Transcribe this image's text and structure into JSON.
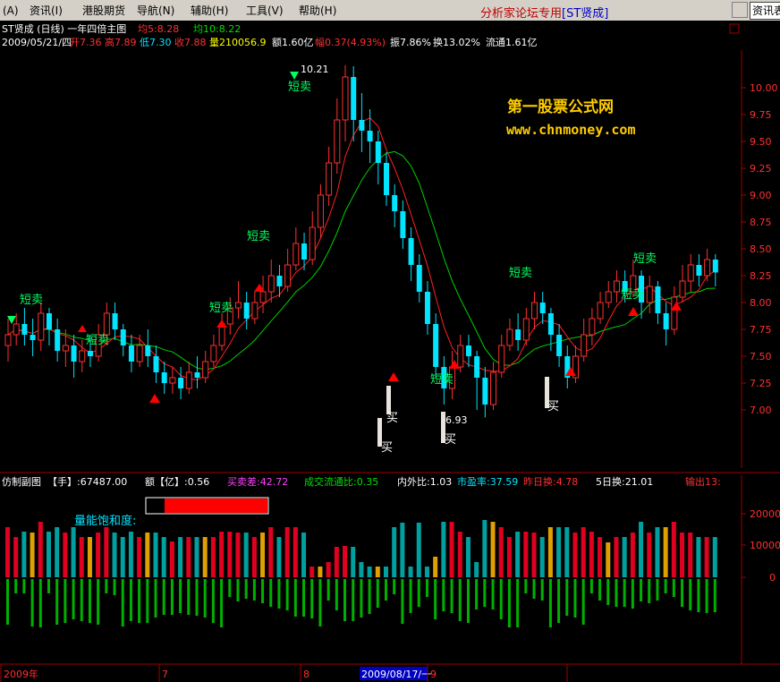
{
  "menubar": {
    "items": [
      "(A)",
      "资讯(I)",
      "港股期货",
      "导航(N)",
      "辅助(H)",
      "工具(V)",
      "帮助(H)"
    ],
    "accent_label": "分析家论坛专用",
    "accent_tag": "[ST贤成]",
    "search_label": "资讯表"
  },
  "chart_header": {
    "title": "ST贤成 (日线) 一年四倍主图",
    "ma5_label": "均5:8.28",
    "ma10_label": "均10:8.22",
    "date": "2009/05/21/四",
    "open": "开7.36",
    "high": "高7.89",
    "low": "低7.30",
    "close": "收7.88",
    "volume": "量210056.9",
    "amount": "额1.60亿",
    "change": "幅0.37(4.93%)",
    "amplitude": "振7.86%",
    "turnover": "换13.02%",
    "float": "流通1.61亿"
  },
  "watermark": {
    "line1": "第一股票公式网",
    "line2": "www.chnmoney.com"
  },
  "annotations": {
    "sell": "短卖",
    "buy": "买",
    "peak_label": "10.21",
    "low_label": "6.93"
  },
  "sub_header": {
    "title": "仿制副图",
    "hand": "【手】:67487.00",
    "amount_yi": "额【亿】:0.56",
    "buy_sell_diff": "买卖差:42.72",
    "circ_ratio": "成交流通比:0.35",
    "in_out_ratio": "内外比:1.03",
    "pe": "市盈率:37.59",
    "yesterday_turn": "昨日换:4.78",
    "five_day_turn": "5日换:21.01",
    "output": "输出13:"
  },
  "saturation_label": "量能饱和度:",
  "date_axis": {
    "labels": [
      "2009年",
      "7",
      "8",
      "2009/08/17/一",
      "9"
    ]
  },
  "colors": {
    "up": "#ff3030",
    "down": "#00e4ff",
    "ma5": "#ff3030",
    "ma10": "#00d000",
    "sell_signal": "#00ff60",
    "buy_signal": "#ff0000",
    "watermark": "#ffcc00"
  },
  "chart_data": {
    "type": "candlestick",
    "price_axis": {
      "ticks": [
        "10.00",
        "9.75",
        "9.50",
        "9.25",
        "9.00",
        "8.75",
        "8.50",
        "8.25",
        "8.00",
        "7.75",
        "7.50",
        "7.25",
        "7.00"
      ],
      "range": [
        6.7,
        10.4
      ]
    },
    "volume_axis": {
      "ticks": [
        "20000",
        "10000",
        "0"
      ]
    },
    "candles": [
      {
        "o": 7.6,
        "c": 7.7,
        "h": 7.85,
        "l": 7.45
      },
      {
        "o": 7.7,
        "c": 7.8,
        "h": 7.9,
        "l": 7.6
      },
      {
        "o": 7.8,
        "c": 7.7,
        "h": 7.95,
        "l": 7.6
      },
      {
        "o": 7.7,
        "c": 7.65,
        "h": 7.85,
        "l": 7.5
      },
      {
        "o": 7.65,
        "c": 7.9,
        "h": 8.0,
        "l": 7.55
      },
      {
        "o": 7.9,
        "c": 7.75,
        "h": 7.95,
        "l": 7.6
      },
      {
        "o": 7.75,
        "c": 7.55,
        "h": 7.85,
        "l": 7.45
      },
      {
        "o": 7.55,
        "c": 7.6,
        "h": 7.75,
        "l": 7.4
      },
      {
        "o": 7.6,
        "c": 7.45,
        "h": 7.7,
        "l": 7.3
      },
      {
        "o": 7.45,
        "c": 7.55,
        "h": 7.65,
        "l": 7.35
      },
      {
        "o": 7.55,
        "c": 7.5,
        "h": 7.7,
        "l": 7.4
      },
      {
        "o": 7.5,
        "c": 7.7,
        "h": 7.8,
        "l": 7.45
      },
      {
        "o": 7.7,
        "c": 7.9,
        "h": 8.0,
        "l": 7.6
      },
      {
        "o": 7.9,
        "c": 7.75,
        "h": 8.0,
        "l": 7.65
      },
      {
        "o": 7.75,
        "c": 7.6,
        "h": 7.8,
        "l": 7.5
      },
      {
        "o": 7.6,
        "c": 7.45,
        "h": 7.7,
        "l": 7.35
      },
      {
        "o": 7.45,
        "c": 7.6,
        "h": 7.7,
        "l": 7.4
      },
      {
        "o": 7.6,
        "c": 7.5,
        "h": 7.75,
        "l": 7.4
      },
      {
        "o": 7.5,
        "c": 7.35,
        "h": 7.6,
        "l": 7.25
      },
      {
        "o": 7.35,
        "c": 7.25,
        "h": 7.45,
        "l": 7.15
      },
      {
        "o": 7.25,
        "c": 7.3,
        "h": 7.4,
        "l": 7.15
      },
      {
        "o": 7.3,
        "c": 7.2,
        "h": 7.4,
        "l": 7.1
      },
      {
        "o": 7.2,
        "c": 7.35,
        "h": 7.45,
        "l": 7.15
      },
      {
        "o": 7.35,
        "c": 7.3,
        "h": 7.5,
        "l": 7.2
      },
      {
        "o": 7.3,
        "c": 7.45,
        "h": 7.55,
        "l": 7.25
      },
      {
        "o": 7.45,
        "c": 7.6,
        "h": 7.7,
        "l": 7.4
      },
      {
        "o": 7.6,
        "c": 7.8,
        "h": 7.9,
        "l": 7.55
      },
      {
        "o": 7.8,
        "c": 7.95,
        "h": 8.05,
        "l": 7.7
      },
      {
        "o": 7.95,
        "c": 8.0,
        "h": 8.2,
        "l": 7.85
      },
      {
        "o": 8.0,
        "c": 7.85,
        "h": 8.1,
        "l": 7.75
      },
      {
        "o": 7.85,
        "c": 8.0,
        "h": 8.1,
        "l": 7.8
      },
      {
        "o": 8.0,
        "c": 8.1,
        "h": 8.25,
        "l": 7.9
      },
      {
        "o": 8.1,
        "c": 8.25,
        "h": 8.4,
        "l": 8.0
      },
      {
        "o": 8.25,
        "c": 8.15,
        "h": 8.35,
        "l": 8.05
      },
      {
        "o": 8.15,
        "c": 8.35,
        "h": 8.5,
        "l": 8.1
      },
      {
        "o": 8.35,
        "c": 8.55,
        "h": 8.7,
        "l": 8.3
      },
      {
        "o": 8.55,
        "c": 8.4,
        "h": 8.65,
        "l": 8.3
      },
      {
        "o": 8.4,
        "c": 8.7,
        "h": 8.85,
        "l": 8.35
      },
      {
        "o": 8.7,
        "c": 9.0,
        "h": 9.1,
        "l": 8.6
      },
      {
        "o": 9.0,
        "c": 9.3,
        "h": 9.45,
        "l": 8.9
      },
      {
        "o": 9.3,
        "c": 9.7,
        "h": 9.9,
        "l": 9.2
      },
      {
        "o": 9.7,
        "c": 10.1,
        "h": 10.21,
        "l": 9.5
      },
      {
        "o": 10.1,
        "c": 9.7,
        "h": 10.2,
        "l": 9.5
      },
      {
        "o": 9.7,
        "c": 9.6,
        "h": 9.95,
        "l": 9.4
      },
      {
        "o": 9.6,
        "c": 9.5,
        "h": 9.8,
        "l": 9.3
      },
      {
        "o": 9.5,
        "c": 9.3,
        "h": 9.6,
        "l": 9.1
      },
      {
        "o": 9.3,
        "c": 9.0,
        "h": 9.4,
        "l": 8.9
      },
      {
        "o": 9.0,
        "c": 8.85,
        "h": 9.1,
        "l": 8.7
      },
      {
        "o": 8.85,
        "c": 8.6,
        "h": 8.95,
        "l": 8.5
      },
      {
        "o": 8.6,
        "c": 8.35,
        "h": 8.7,
        "l": 8.2
      },
      {
        "o": 8.35,
        "c": 8.1,
        "h": 8.45,
        "l": 8.0
      },
      {
        "o": 8.1,
        "c": 7.8,
        "h": 8.2,
        "l": 7.7
      },
      {
        "o": 7.8,
        "c": 7.4,
        "h": 7.9,
        "l": 7.3
      },
      {
        "o": 7.4,
        "c": 7.2,
        "h": 7.5,
        "l": 7.05
      },
      {
        "o": 7.2,
        "c": 7.4,
        "h": 7.55,
        "l": 7.1
      },
      {
        "o": 7.4,
        "c": 7.6,
        "h": 7.7,
        "l": 7.35
      },
      {
        "o": 7.6,
        "c": 7.5,
        "h": 7.7,
        "l": 7.4
      },
      {
        "o": 7.5,
        "c": 7.3,
        "h": 7.55,
        "l": 7.0
      },
      {
        "o": 7.3,
        "c": 7.05,
        "h": 7.4,
        "l": 6.93
      },
      {
        "o": 7.05,
        "c": 7.35,
        "h": 7.45,
        "l": 7.0
      },
      {
        "o": 7.35,
        "c": 7.6,
        "h": 7.7,
        "l": 7.3
      },
      {
        "o": 7.6,
        "c": 7.75,
        "h": 7.85,
        "l": 7.55
      },
      {
        "o": 7.75,
        "c": 7.65,
        "h": 7.9,
        "l": 7.55
      },
      {
        "o": 7.65,
        "c": 7.85,
        "h": 7.95,
        "l": 7.6
      },
      {
        "o": 7.85,
        "c": 8.0,
        "h": 8.1,
        "l": 7.75
      },
      {
        "o": 8.0,
        "c": 7.9,
        "h": 8.1,
        "l": 7.8
      },
      {
        "o": 7.9,
        "c": 7.7,
        "h": 7.95,
        "l": 7.55
      },
      {
        "o": 7.7,
        "c": 7.5,
        "h": 7.8,
        "l": 7.4
      },
      {
        "o": 7.5,
        "c": 7.3,
        "h": 7.6,
        "l": 7.2
      },
      {
        "o": 7.3,
        "c": 7.5,
        "h": 7.6,
        "l": 7.25
      },
      {
        "o": 7.5,
        "c": 7.7,
        "h": 7.85,
        "l": 7.45
      },
      {
        "o": 7.7,
        "c": 7.85,
        "h": 7.95,
        "l": 7.6
      },
      {
        "o": 7.85,
        "c": 8.0,
        "h": 8.1,
        "l": 7.8
      },
      {
        "o": 8.0,
        "c": 8.1,
        "h": 8.2,
        "l": 7.95
      },
      {
        "o": 8.1,
        "c": 8.2,
        "h": 8.3,
        "l": 8.0
      },
      {
        "o": 8.2,
        "c": 8.1,
        "h": 8.3,
        "l": 8.0
      },
      {
        "o": 8.1,
        "c": 8.25,
        "h": 8.4,
        "l": 8.05
      },
      {
        "o": 8.25,
        "c": 8.0,
        "h": 8.3,
        "l": 7.85
      },
      {
        "o": 8.0,
        "c": 8.15,
        "h": 8.25,
        "l": 7.9
      },
      {
        "o": 8.15,
        "c": 7.9,
        "h": 8.2,
        "l": 7.8
      },
      {
        "o": 7.9,
        "c": 7.75,
        "h": 8.0,
        "l": 7.6
      },
      {
        "o": 7.75,
        "c": 8.05,
        "h": 8.15,
        "l": 7.7
      },
      {
        "o": 8.05,
        "c": 8.2,
        "h": 8.35,
        "l": 8.0
      },
      {
        "o": 8.2,
        "c": 8.35,
        "h": 8.45,
        "l": 8.1
      },
      {
        "o": 8.35,
        "c": 8.25,
        "h": 8.45,
        "l": 8.15
      },
      {
        "o": 8.25,
        "c": 8.4,
        "h": 8.5,
        "l": 8.2
      },
      {
        "o": 8.4,
        "c": 8.28,
        "h": 8.45,
        "l": 8.15
      }
    ]
  }
}
